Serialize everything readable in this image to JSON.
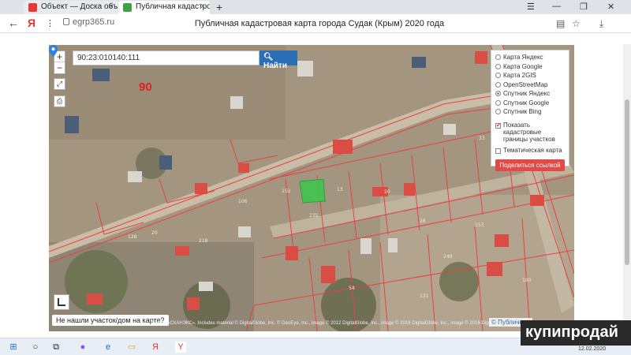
{
  "browser": {
    "tabs": [
      {
        "title": "Объект — Доска объявлен",
        "favicon_color": "#e53935"
      },
      {
        "title": "Публичная кадастровая",
        "favicon_color": "#43a047"
      }
    ],
    "new_tab": "+",
    "url": "egrp365.ru",
    "page_title": "Публичная кадастровая карта города Судак (Крым) 2020 года"
  },
  "map": {
    "search_value": "90:23:010140:111",
    "search_button": "Найти",
    "zoom_in": "+",
    "zoom_out": "−",
    "big_number": "90",
    "layers": [
      {
        "label": "Карта Яндекс",
        "selected": false
      },
      {
        "label": "Карта Google",
        "selected": false
      },
      {
        "label": "Карта 2GIS",
        "selected": false
      },
      {
        "label": "OpenStreetMap",
        "selected": false
      },
      {
        "label": "Спутник Яндекс",
        "selected": true
      },
      {
        "label": "Спутник Google",
        "selected": false
      },
      {
        "label": "Спутник Bing",
        "selected": false
      }
    ],
    "show_cadastral": {
      "label": "Показать кадастровые границы участков",
      "checked": true
    },
    "thematic_map": {
      "label": "Тематическая карта",
      "checked": false
    },
    "share_button": "Поделиться ссылкой",
    "not_found_link": "Не нашли участок/дом на карте?",
    "copyright": "© НТЦ «СКАНЭКС», Includes material © DigitalGlobe, Inc. © GeoEye, Inc., image © 2012 DigitalGlobe, Inc., image © 2016 DigitalGlobe, Inc., image © 2016 DigitalGlobe, Inc",
    "yandex_link": "© Публичная",
    "accent_color": "#2a6fb5",
    "boundary_color": "#e8423f",
    "highlight_color": "#3cc84a"
  },
  "watermark": "купипродай",
  "taskbar": {
    "date": "12.02.2020"
  }
}
